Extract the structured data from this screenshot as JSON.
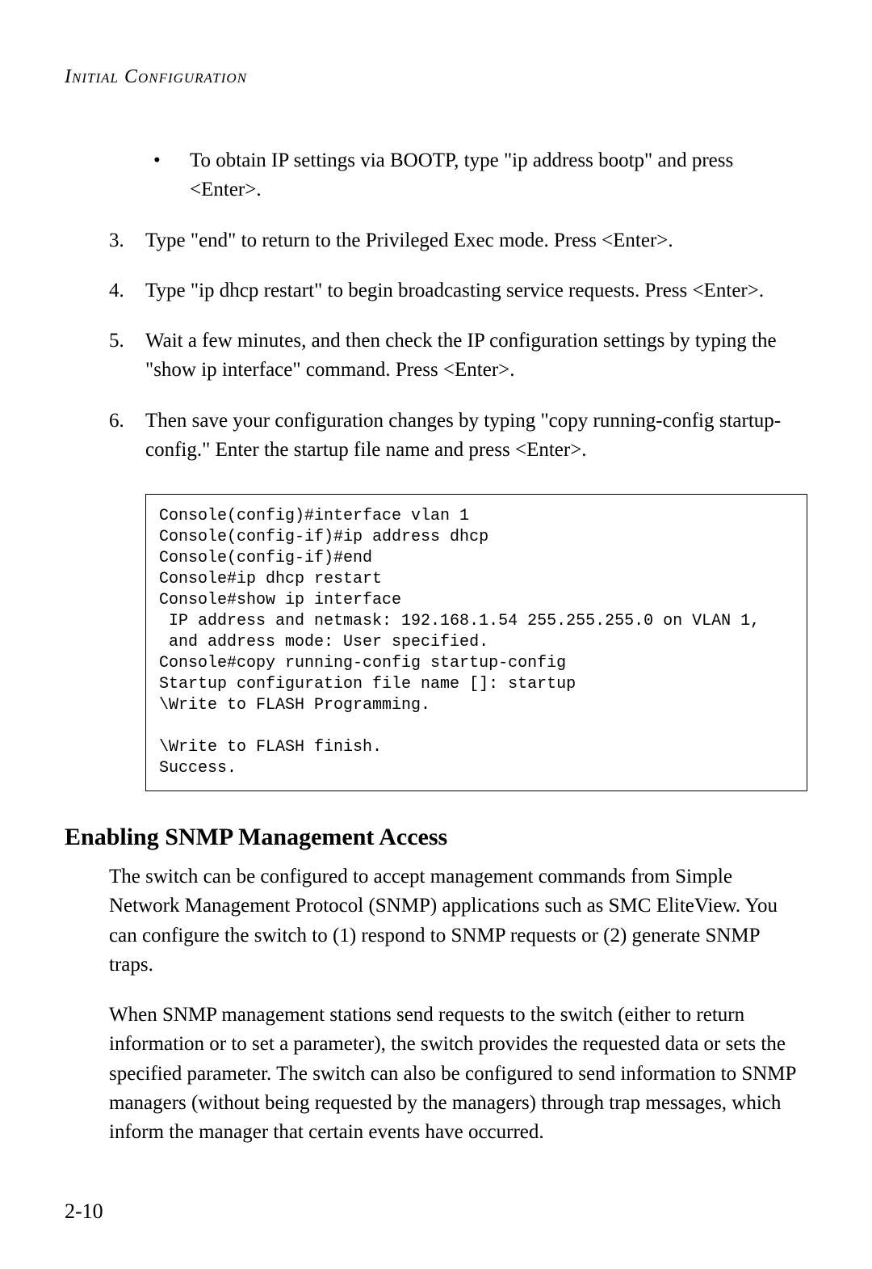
{
  "header": "Initial Configuration",
  "bullet": {
    "marker": "•",
    "text": "To obtain IP settings via BOOTP, type \"ip address bootp\" and press <Enter>."
  },
  "steps": [
    {
      "num": "3.",
      "text": "Type \"end\" to return to the Privileged Exec mode. Press <Enter>."
    },
    {
      "num": "4.",
      "text": "Type \"ip dhcp restart\" to begin broadcasting service requests. Press <Enter>."
    },
    {
      "num": "5.",
      "text": "Wait a few minutes, and then check the IP configuration settings by typing the \"show ip interface\" command. Press <Enter>."
    },
    {
      "num": "6.",
      "text": "Then save your configuration changes by typing \"copy running-config startup-config.\" Enter the startup file name and press <Enter>."
    }
  ],
  "code": "Console(config)#interface vlan 1\nConsole(config-if)#ip address dhcp\nConsole(config-if)#end\nConsole#ip dhcp restart\nConsole#show ip interface\n IP address and netmask: 192.168.1.54 255.255.255.0 on VLAN 1,\n and address mode: User specified.\nConsole#copy running-config startup-config\nStartup configuration file name []: startup\n\\Write to FLASH Programming.\n\n\\Write to FLASH finish.\nSuccess.",
  "section_heading": "Enabling SNMP Management Access",
  "paragraphs": [
    "The switch can be configured to accept management commands from Simple Network Management Protocol (SNMP) applications such as SMC EliteView. You can configure the switch to (1) respond to SNMP requests or (2) generate SNMP traps.",
    "When SNMP management stations send requests to the switch (either to return information or to set a parameter), the switch provides the requested data or sets the specified parameter. The switch can also be configured to send information to SNMP managers (without being requested by the managers) through trap messages, which inform the manager that certain events have occurred."
  ],
  "page_number": "2-10"
}
